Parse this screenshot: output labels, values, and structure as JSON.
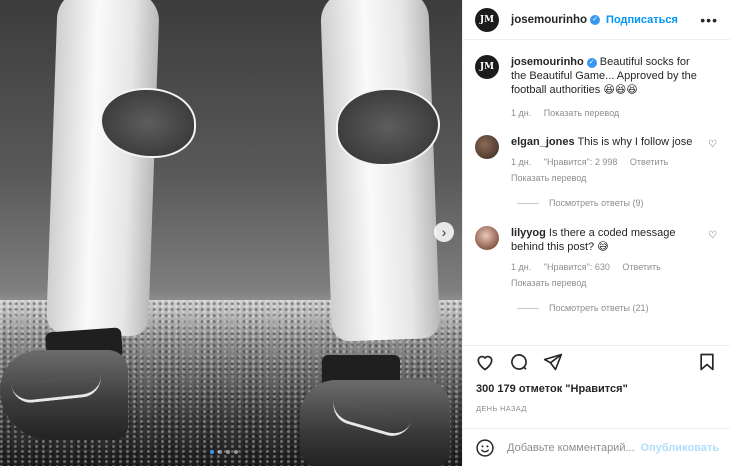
{
  "post": {
    "username": "josemourinho",
    "avatar_text": "JM",
    "follow_label": "Подписаться",
    "more_label": "•••",
    "caption": "Beautiful socks for the Beautiful Game... Approved by the football authorities",
    "caption_emojis": [
      "😆",
      "😆",
      "😆"
    ],
    "caption_time": "1 дн.",
    "caption_translate": "Показать перевод"
  },
  "comments": [
    {
      "username": "elgan_jones",
      "text": "This is why I follow jose",
      "time": "1 дн.",
      "likes": "\"Нравится\": 2 998",
      "reply": "Ответить",
      "translate": "Показать перевод",
      "view_replies": "Посмотреть ответы (9)"
    },
    {
      "username": "lilyyog",
      "text": "Is there a coded message behind this post?",
      "emoji": "😅",
      "time": "1 дн.",
      "likes": "\"Нравится\": 630",
      "reply": "Ответить",
      "translate": "Показать перевод",
      "view_replies": "Посмотреть ответы (21)"
    }
  ],
  "stats": {
    "likes": "300 179 отметок \"Нравится\"",
    "posted": "ДЕНЬ НАЗАД"
  },
  "composer": {
    "placeholder": "Добавьте комментарий...",
    "publish": "Опубликовать"
  },
  "icons": {
    "verified": "verified-badge-icon",
    "like": "heart-icon",
    "comment": "comment-icon",
    "share": "send-icon",
    "save": "bookmark-icon",
    "emoji": "smile-icon",
    "next": "chevron-right-icon"
  },
  "colors": {
    "accent": "#0095f6",
    "verified": "#3897f0",
    "muted": "#8e8e8e"
  }
}
